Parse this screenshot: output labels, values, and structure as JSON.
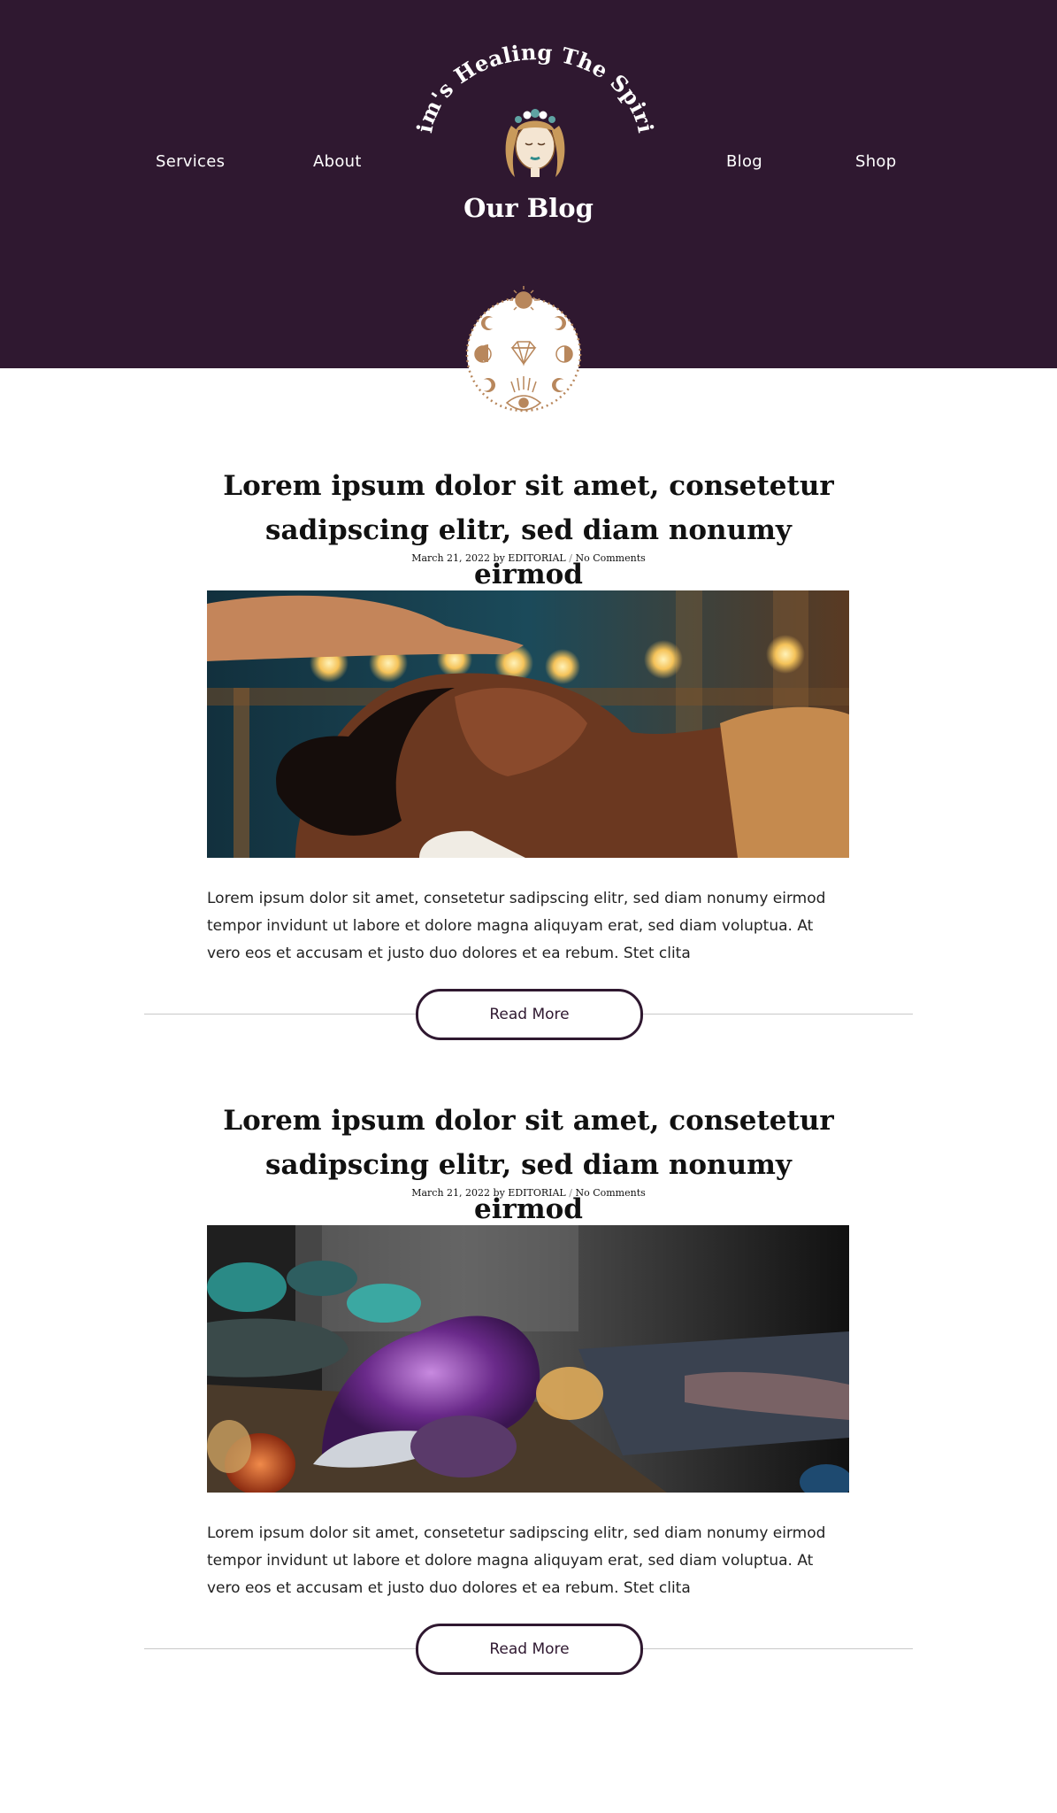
{
  "header": {
    "brand_name": "Jim's Healing The Spirit",
    "nav_left": [
      {
        "label": "Services"
      },
      {
        "label": "About"
      }
    ],
    "nav_right": [
      {
        "label": "Blog"
      },
      {
        "label": "Shop"
      }
    ],
    "page_title": "Our Blog"
  },
  "colors": {
    "header_bg": "#2f1830",
    "accent_gold": "#b8875c",
    "button_border": "#2f1830"
  },
  "posts": [
    {
      "title_line1": "Lorem ipsum dolor sit amet, consetetur",
      "title_line2": "sadipscing elitr, sed diam nonumy eirmod",
      "date": "March 21, 2022",
      "by": "by",
      "author": "EDITORIAL",
      "separator": "/",
      "comments": "No Comments",
      "image": "reiki-healing-photo",
      "excerpt": "Lorem ipsum dolor sit amet, consetetur sadipscing elitr, sed diam nonumy eirmod tempor invidunt ut labore et dolore magna aliquyam erat, sed diam voluptua. At vero eos et accusam et justo duo dolores et ea rebum. Stet clita",
      "button_label": "Read More"
    },
    {
      "title_line1": "Lorem ipsum dolor sit amet, consetetur",
      "title_line2": "sadipscing elitr, sed diam nonumy eirmod",
      "date": "March 21, 2022",
      "by": "by",
      "author": "EDITORIAL",
      "separator": "/",
      "comments": "No Comments",
      "image": "crystals-photo",
      "excerpt": "Lorem ipsum dolor sit amet, consetetur sadipscing elitr, sed diam nonumy eirmod tempor invidunt ut labore et dolore magna aliquyam erat, sed diam voluptua. At vero eos et accusam et justo duo dolores et ea rebum. Stet clita",
      "button_label": "Read More"
    }
  ]
}
